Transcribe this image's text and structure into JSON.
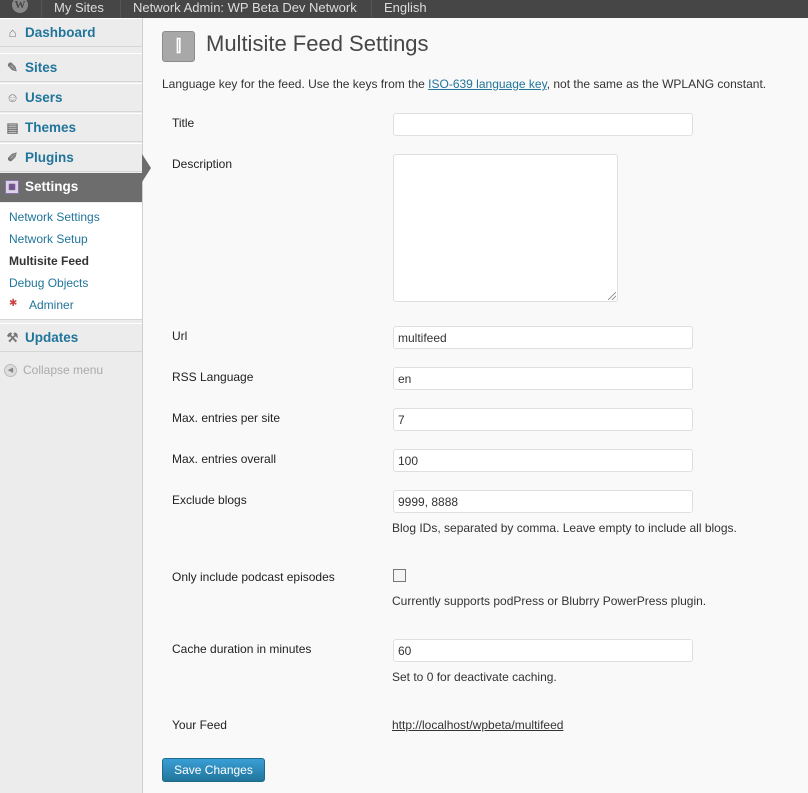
{
  "adminbar": {
    "wp_logo": "W",
    "my_sites": "My Sites",
    "network": "Network Admin: WP Beta Dev Network",
    "language": "English"
  },
  "menu": {
    "items": [
      {
        "label": "Dashboard",
        "icon": "home-icon"
      },
      {
        "label": "Sites",
        "icon": "tools-icon"
      },
      {
        "label": "Users",
        "icon": "users-icon"
      },
      {
        "label": "Themes",
        "icon": "themes-icon"
      },
      {
        "label": "Plugins",
        "icon": "plugin-icon"
      },
      {
        "label": "Settings",
        "icon": "settings-icon"
      },
      {
        "label": "Updates",
        "icon": "updates-icon"
      }
    ],
    "submenu": [
      "Network Settings",
      "Network Setup",
      "Multisite Feed",
      "Debug Objects",
      "Adminer"
    ],
    "collapse": "Collapse menu"
  },
  "page": {
    "title": "Multisite Feed Settings",
    "intro_before": "Language key for the feed. Use the keys from the ",
    "intro_link": "ISO-639 language key",
    "intro_after": ", not the same as the WPLANG constant."
  },
  "form": {
    "title_label": "Title",
    "title_value": "",
    "description_label": "Description",
    "url_label": "Url",
    "url_value": "multifeed",
    "rss_label": "RSS Language",
    "rss_value": "en",
    "max_site_label": "Max. entries per site",
    "max_site_value": "7",
    "max_overall_label": "Max. entries overall",
    "max_overall_value": "100",
    "exclude_label": "Exclude blogs",
    "exclude_value": "9999, 8888",
    "exclude_help": "Blog IDs, separated by comma. Leave empty to include all blogs.",
    "podcast_label": "Only include podcast episodes",
    "podcast_checked": false,
    "podcast_help": "Currently supports podPress or Blubrry PowerPress plugin.",
    "cache_label": "Cache duration in minutes",
    "cache_value": "60",
    "cache_help": "Set to 0 for deactivate caching.",
    "feed_label": "Your Feed",
    "feed_link": "http://localhost/wpbeta/multifeed",
    "save_label": "Save Changes"
  },
  "colors": {
    "link": "#21759b",
    "adminbar": "#464646",
    "active_menu": "#6d6d6d",
    "button": "#21759b"
  }
}
